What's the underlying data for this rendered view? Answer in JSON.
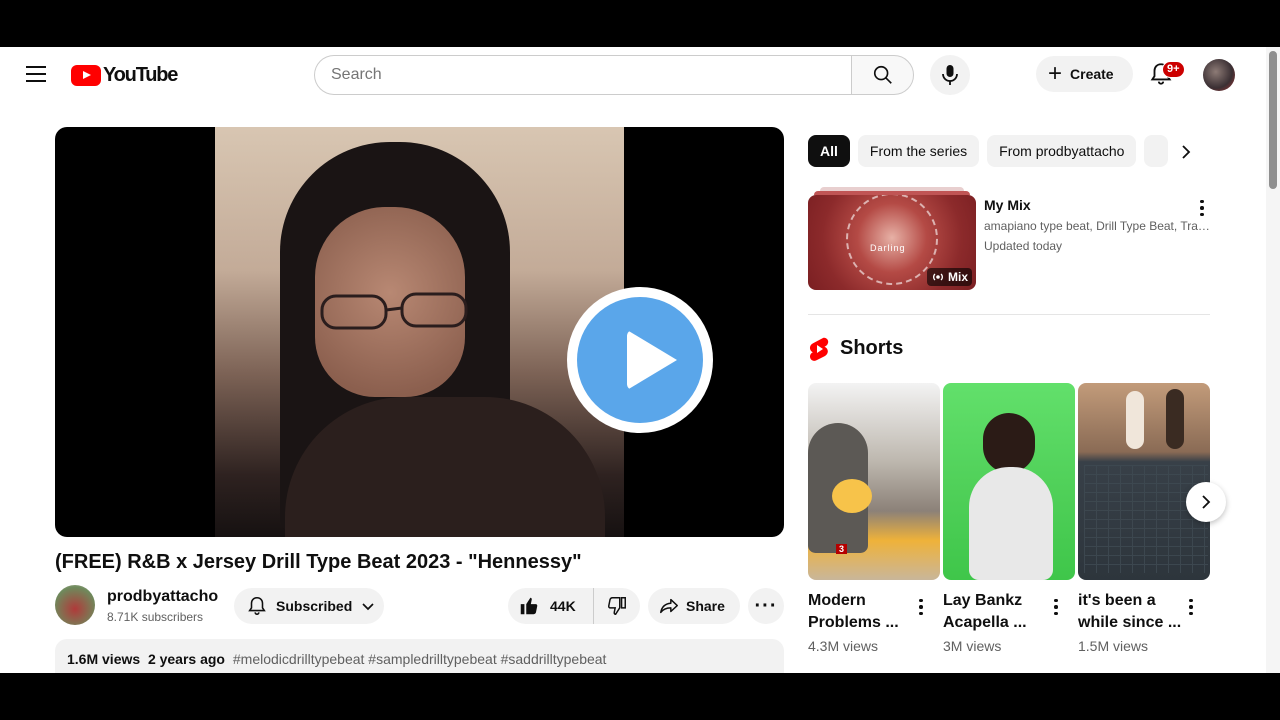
{
  "header": {
    "logo_text": "YouTube",
    "search_placeholder": "Search",
    "create_label": "Create",
    "notification_count": "9+"
  },
  "video": {
    "title": "(FREE) R&B x Jersey Drill Type Beat 2023 - \"Hennessy\"",
    "channel_name": "prodbyattacho",
    "subscribers": "8.71K subscribers",
    "subscribe_label": "Subscribed",
    "likes": "44K",
    "share_label": "Share",
    "views": "1.6M views",
    "age": "2 years ago",
    "hashtags": "#melodicdrilltypebeat #sampledrilltypebeat #saddrilltypebeat"
  },
  "sidebar": {
    "chips": [
      {
        "label": "All",
        "active": true
      },
      {
        "label": "From the series",
        "active": false
      },
      {
        "label": "From prodbyattacho",
        "active": false
      }
    ],
    "mix": {
      "thumb_text": "Darling",
      "badge": "Mix",
      "title": "My Mix",
      "subtitle": "amapiano type beat, Drill Type Beat, Tran...",
      "updated": "Updated today"
    },
    "shorts_heading": "Shorts",
    "shorts": [
      {
        "title": "Modern Problems ...",
        "views": "4.3M views",
        "tag": "3"
      },
      {
        "title": "Lay Bankz Acapella ...",
        "views": "3M views"
      },
      {
        "title": "it's been a while since ...",
        "views": "1.5M views"
      }
    ]
  },
  "colors": {
    "brand_red": "#ff0000",
    "play_blue": "#5aa6ea",
    "chip_active": "#0f0f0f",
    "chip_bg": "#f2f2f2",
    "secondary_text": "#606060"
  },
  "icons": [
    "menu-icon",
    "search-icon",
    "mic-icon",
    "plus-icon",
    "bell-icon",
    "play-icon",
    "bell-icon",
    "chevron-down-icon",
    "thumbs-up-icon",
    "thumbs-down-icon",
    "share-icon",
    "more-icon",
    "chevron-right-icon",
    "shorts-icon",
    "kebab-icon"
  ]
}
